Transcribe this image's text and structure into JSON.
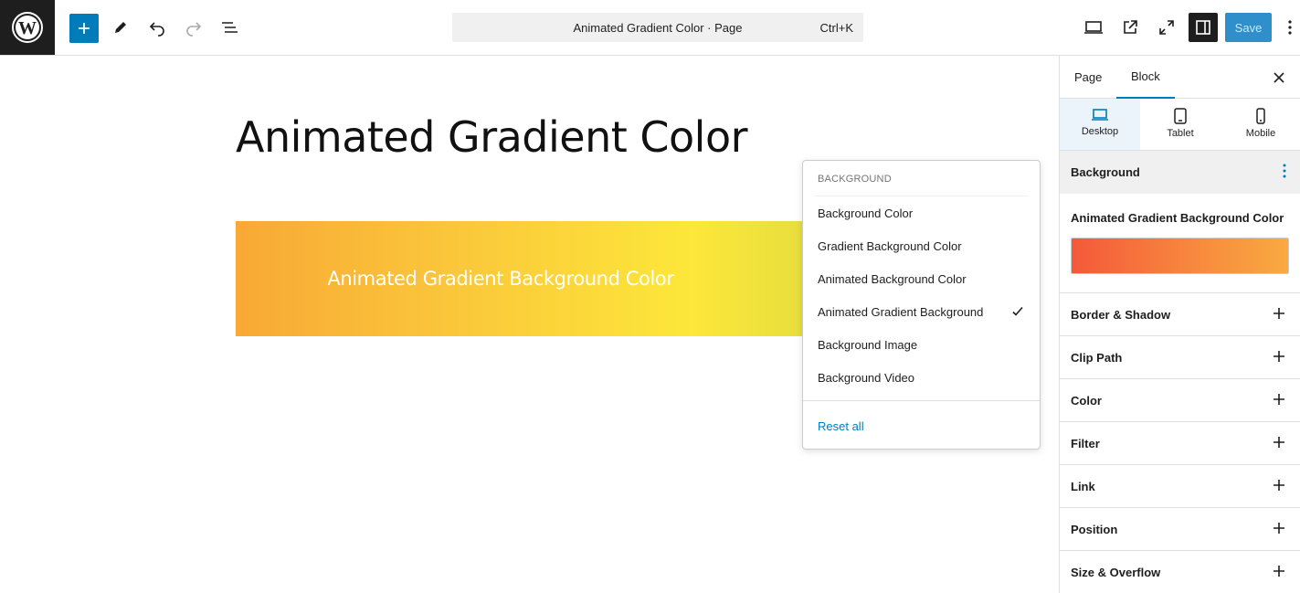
{
  "topbar": {
    "command_title": "Animated Gradient Color · Page",
    "command_shortcut": "Ctrl+K",
    "save_label": "Save"
  },
  "canvas": {
    "page_title": "Animated Gradient Color",
    "block_text": "Animated Gradient Background Color",
    "block_gradient_colors": [
      "#f8a935",
      "#fac53a",
      "#fde73a",
      "#e5dd3e"
    ]
  },
  "menu": {
    "header": "Background",
    "items": [
      {
        "label": "Background Color",
        "checked": false
      },
      {
        "label": "Gradient Background Color",
        "checked": false
      },
      {
        "label": "Animated Background Color",
        "checked": false
      },
      {
        "label": "Animated Gradient Background",
        "checked": true
      },
      {
        "label": "Background Image",
        "checked": false
      },
      {
        "label": "Background Video",
        "checked": false
      }
    ],
    "reset_label": "Reset all"
  },
  "sidebar": {
    "tabs": [
      {
        "label": "Page",
        "active": false
      },
      {
        "label": "Block",
        "active": true
      }
    ],
    "devices": [
      {
        "label": "Desktop",
        "icon": "desktop-icon",
        "active": true
      },
      {
        "label": "Tablet",
        "icon": "tablet-icon",
        "active": false
      },
      {
        "label": "Mobile",
        "icon": "mobile-icon",
        "active": false
      }
    ],
    "background_panel_title": "Background",
    "gradient_control_label": "Animated Gradient Background Color",
    "gradient_swatch_colors": [
      "#f4593a",
      "#f7833d",
      "#f9aa40"
    ],
    "panels": [
      {
        "label": "Border & Shadow"
      },
      {
        "label": "Clip Path"
      },
      {
        "label": "Color"
      },
      {
        "label": "Filter"
      },
      {
        "label": "Link"
      },
      {
        "label": "Position"
      },
      {
        "label": "Size & Overflow"
      }
    ]
  },
  "colors": {
    "accent": "#007cba",
    "dark": "#1e1e1e"
  }
}
